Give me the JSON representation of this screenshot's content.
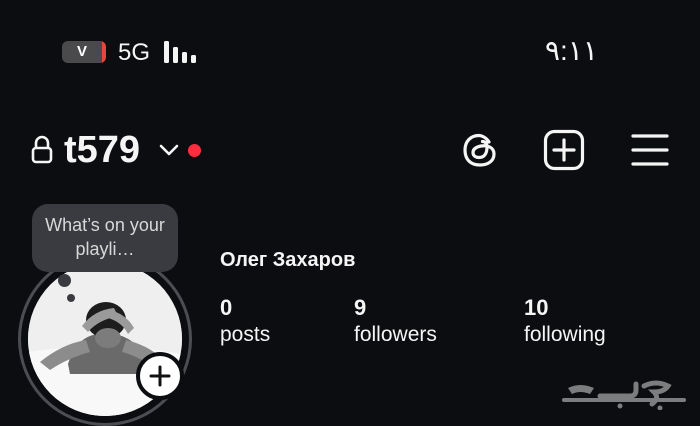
{
  "status_bar": {
    "battery_label": "V",
    "battery_level": 0.08,
    "network": "5G",
    "time": "٩:١١"
  },
  "header": {
    "username": "t579"
  },
  "profile": {
    "note": "What’s on your playli…",
    "display_name": "Олег Захаров",
    "stats": {
      "posts": {
        "count": "0",
        "label": "posts"
      },
      "followers": {
        "count": "9",
        "label": "followers"
      },
      "following": {
        "count": "10",
        "label": "following"
      }
    }
  },
  "icons": {
    "lock": "lock-icon",
    "chevron": "chevron-down-icon",
    "threads": "threads-icon",
    "create": "plus-square-icon",
    "menu": "hamburger-menu-icon",
    "add_story": "plus-icon"
  },
  "colors": {
    "background": "#0c0d10",
    "notification_dot": "#ff2d3d",
    "battery_low": "#e8453c",
    "bubble": "#3a3b40"
  },
  "watermark": "حراج"
}
